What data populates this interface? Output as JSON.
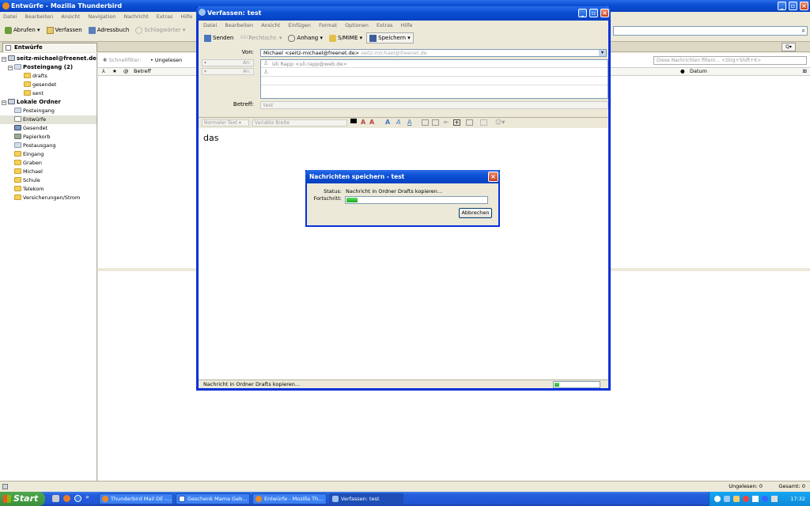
{
  "main": {
    "title": "Entwürfe - Mozilla Thunderbird",
    "menu": [
      "Datei",
      "Bearbeiten",
      "Ansicht",
      "Navigation",
      "Nachricht",
      "Extras",
      "Hilfe"
    ],
    "toolbar": {
      "get": "Abrufen",
      "write": "Verfassen",
      "addressbook": "Adressbuch",
      "tags": "Schlagwörter"
    },
    "tab": "Entwürfe",
    "quickfilter": {
      "label": "Schnellfilter:",
      "unread": "Ungelesen"
    },
    "filter_placeholder": "Diese Nachrichten filtern... <Strg+Shift+K>",
    "columns": {
      "subject": "Betreff",
      "date": "Datum"
    },
    "folders": [
      {
        "label": "seitz-michael@freenet.de",
        "kind": "acct",
        "bold": true
      },
      {
        "label": "Posteingang (2)",
        "kind": "inbox",
        "bold": true
      },
      {
        "label": "drafts",
        "kind": "folder"
      },
      {
        "label": "gesendet",
        "kind": "folder"
      },
      {
        "label": "sent",
        "kind": "folder"
      },
      {
        "label": "Lokale Ordner",
        "kind": "acct",
        "bold": true
      },
      {
        "label": "Posteingang",
        "kind": "inbox"
      },
      {
        "label": "Entwürfe",
        "kind": "draft",
        "selected": true
      },
      {
        "label": "Gesendet",
        "kind": "sent"
      },
      {
        "label": "Papierkorb",
        "kind": "trash"
      },
      {
        "label": "Postausgang",
        "kind": "inbox"
      },
      {
        "label": "Eingang",
        "kind": "folder"
      },
      {
        "label": "Graben",
        "kind": "folder"
      },
      {
        "label": "Michael",
        "kind": "folder"
      },
      {
        "label": "Schule",
        "kind": "folder"
      },
      {
        "label": "Telekom",
        "kind": "folder"
      },
      {
        "label": "Versicherungen/Strom",
        "kind": "folder"
      }
    ],
    "status": {
      "unread": "Ungelesen: 0",
      "total": "Gesamt: 0"
    }
  },
  "compose": {
    "title": "Verfassen: test",
    "menu": [
      "Datei",
      "Bearbeiten",
      "Ansicht",
      "Einfügen",
      "Format",
      "Optionen",
      "Extras",
      "Hilfe"
    ],
    "toolbar": {
      "send": "Senden",
      "spell": "Rechtschr.",
      "attach": "Anhang",
      "smime": "S/MIME",
      "save": "Speichern"
    },
    "from_label": "Von:",
    "from_value": "Michael <seitz-michael@freenet.de>",
    "from_hint": "seitz-michael@freenet.de",
    "to_label": "An:",
    "to_value": "Uli Rapp <uli.rapp@web.de>",
    "subject_label": "Betreff:",
    "subject_value": "test",
    "format": {
      "paragraph": "Normaler Text",
      "font": "Variable Breite"
    },
    "body": "das",
    "status_text": "Nachricht in Ordner Drafts kopieren...",
    "progress": 0.1
  },
  "dialog": {
    "title": "Nachrichten speichern - test",
    "status_label": "Status:",
    "status_value": "Nachricht in Ordner Drafts kopieren...",
    "progress_label": "Fortschritt:",
    "progress": 0.08,
    "cancel": "Abbrechen"
  },
  "taskbar": {
    "start": "Start",
    "items": [
      "Thunderbird Mail DE -...",
      "Geschenk Mama Geb...",
      "Entwürfe - Mozilla Th...",
      "Verfassen: test"
    ],
    "clock": "17:32"
  }
}
